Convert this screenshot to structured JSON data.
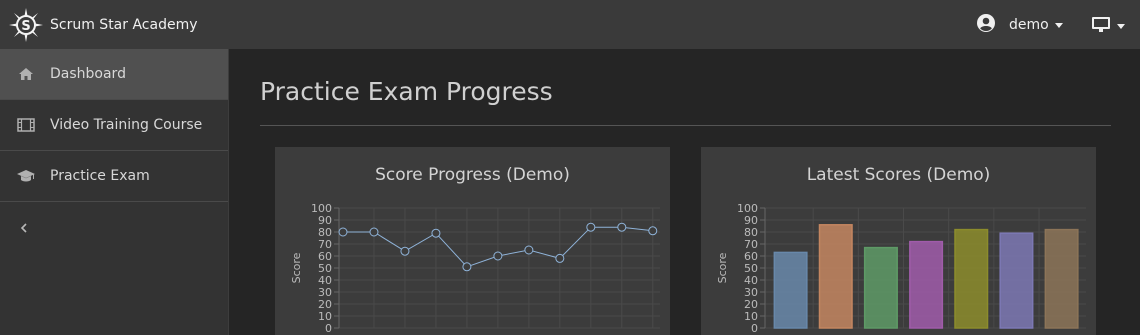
{
  "brand": {
    "name": "Scrum Star Academy"
  },
  "user": {
    "name": "demo"
  },
  "sidebar": {
    "items": [
      {
        "label": "Dashboard",
        "icon": "home-icon",
        "active": true
      },
      {
        "label": "Video Training Course",
        "icon": "film-icon",
        "active": false
      },
      {
        "label": "Practice Exam",
        "icon": "graduation-cap-icon",
        "active": false
      }
    ],
    "collapse_glyph": "‹"
  },
  "main": {
    "title": "Practice Exam Progress"
  },
  "colors": {
    "accent_line": "#8fb3d9"
  },
  "chart_data": [
    {
      "type": "line",
      "title": "Score Progress (Demo)",
      "ylabel": "Score",
      "ylim": [
        0,
        100
      ],
      "yticks": [
        0,
        10,
        20,
        30,
        40,
        50,
        60,
        70,
        80,
        90,
        100
      ],
      "values": [
        80,
        80,
        64,
        79,
        51,
        60,
        65,
        58,
        84,
        84,
        81
      ],
      "color": "#8fb3d9",
      "grid": true
    },
    {
      "type": "bar",
      "title": "Latest Scores (Demo)",
      "ylabel": "Score",
      "ylim": [
        0,
        100
      ],
      "yticks": [
        0,
        10,
        20,
        30,
        40,
        50,
        60,
        70,
        80,
        90,
        100
      ],
      "values": [
        63,
        86,
        67,
        72,
        82,
        79,
        82
      ],
      "colors": [
        "#6888aa",
        "#c48660",
        "#5e9a66",
        "#a05caa",
        "#8c8c2c",
        "#7c78b4",
        "#8c7458"
      ],
      "grid": true
    }
  ]
}
